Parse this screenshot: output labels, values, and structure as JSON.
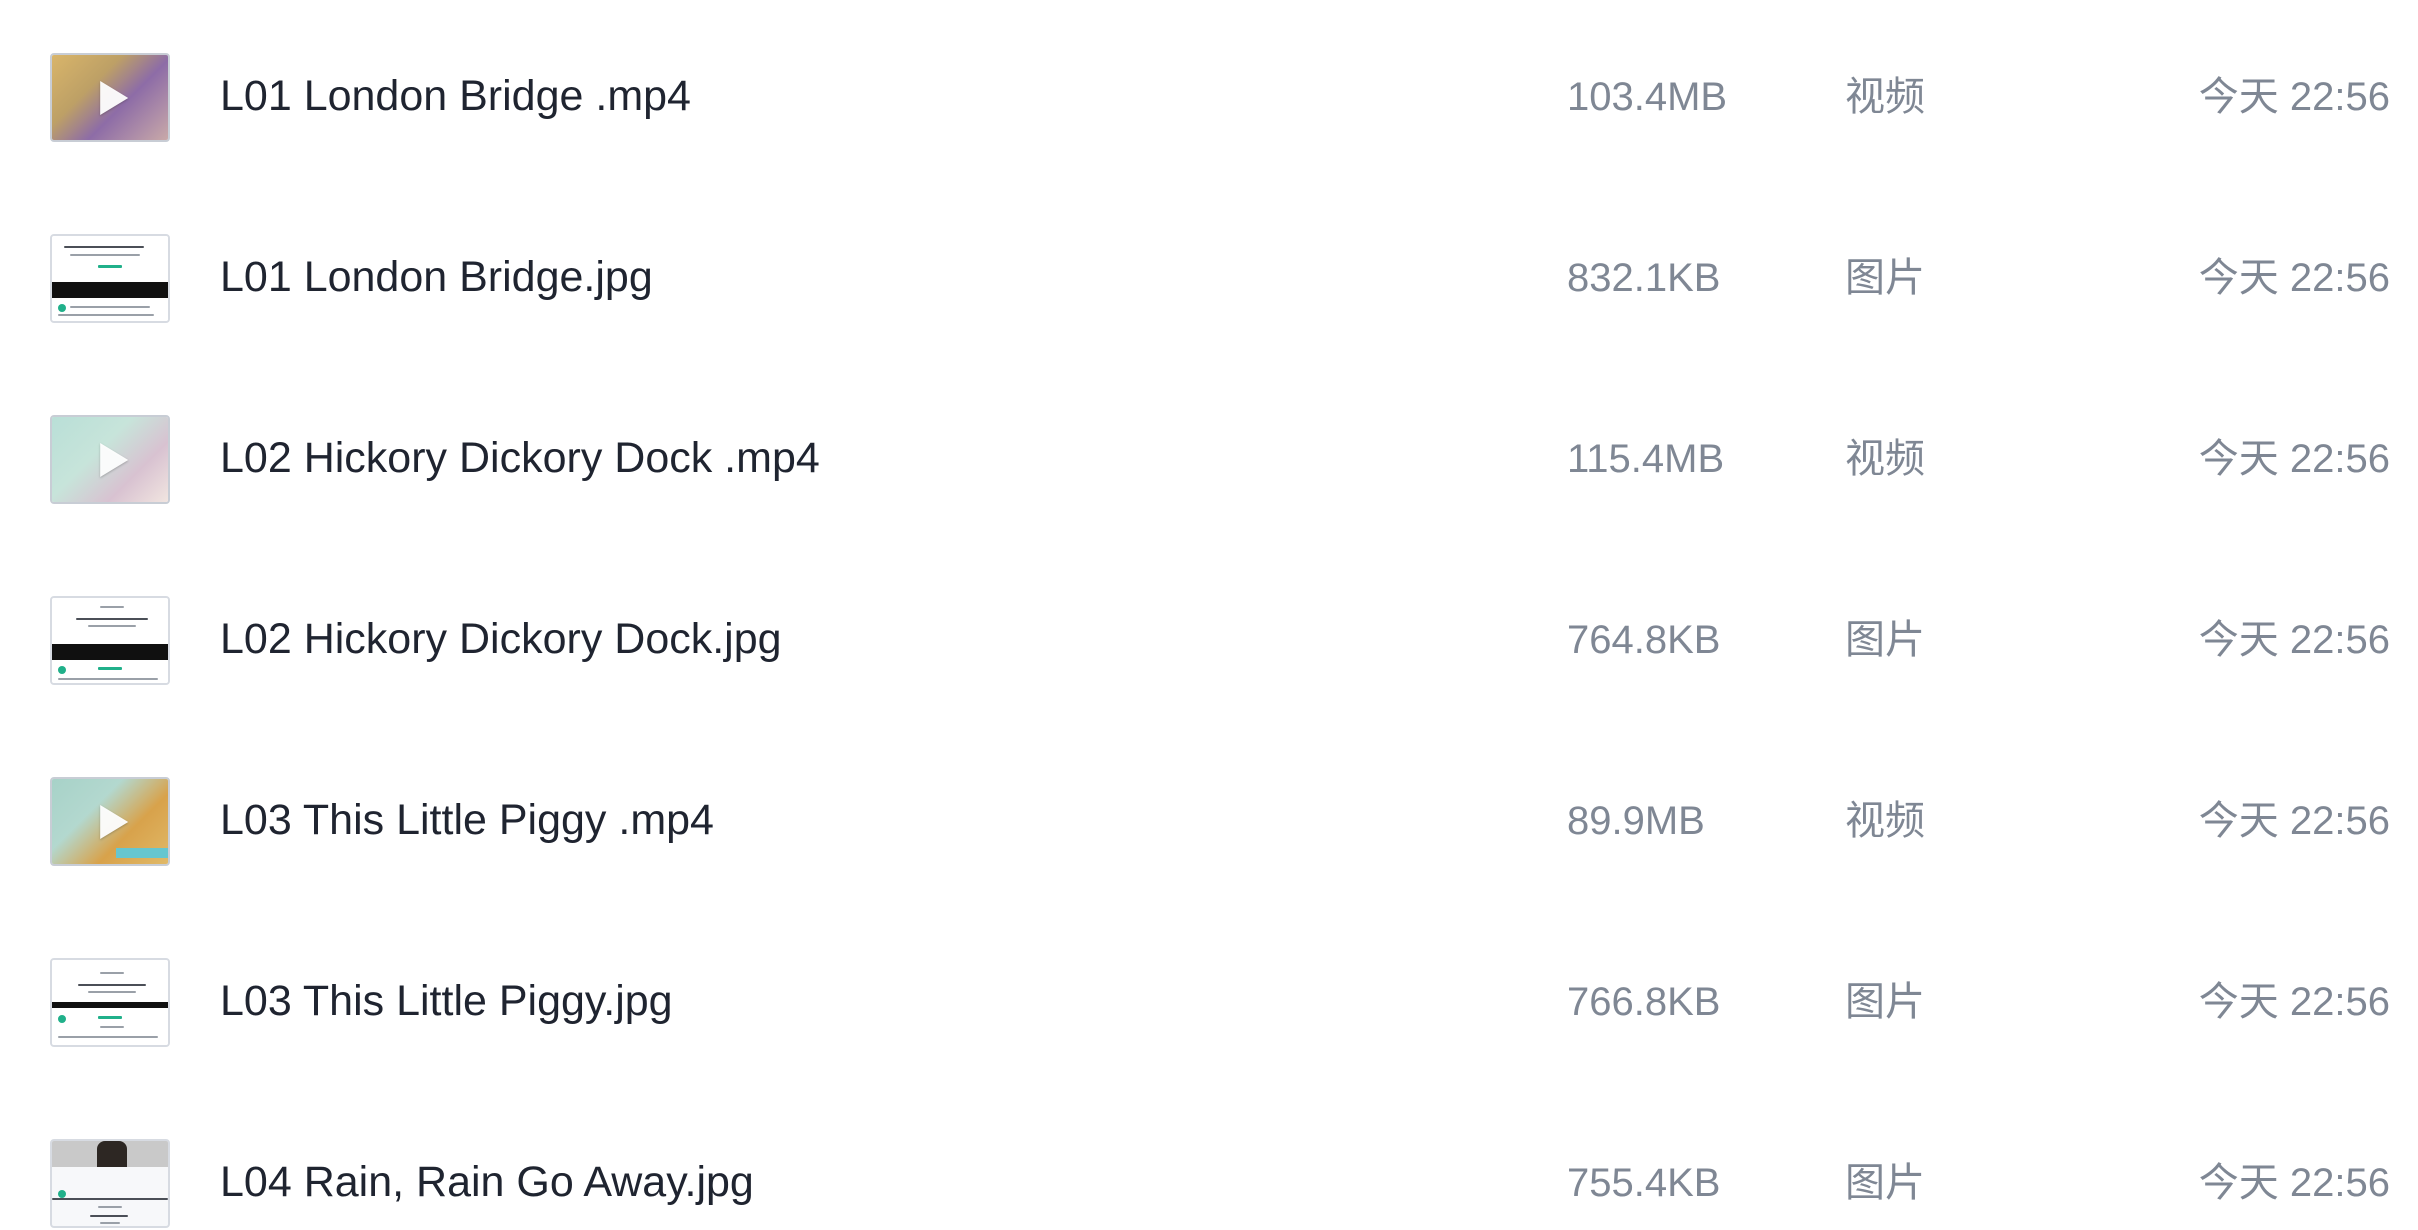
{
  "files": [
    {
      "name": "L01 London Bridge .mp4",
      "size": "103.4MB",
      "type": "视频",
      "time": "今天 22:56",
      "thumbnail": "video-thumbnail-icon"
    },
    {
      "name": "L01 London Bridge.jpg",
      "size": "832.1KB",
      "type": "图片",
      "time": "今天 22:56",
      "thumbnail": "image-thumbnail-icon"
    },
    {
      "name": "L02 Hickory Dickory Dock .mp4",
      "size": "115.4MB",
      "type": "视频",
      "time": "今天 22:56",
      "thumbnail": "video-thumbnail-icon"
    },
    {
      "name": "L02 Hickory Dickory Dock.jpg",
      "size": "764.8KB",
      "type": "图片",
      "time": "今天 22:56",
      "thumbnail": "image-thumbnail-icon"
    },
    {
      "name": "L03 This Little Piggy .mp4",
      "size": "89.9MB",
      "type": "视频",
      "time": "今天 22:56",
      "thumbnail": "video-thumbnail-icon"
    },
    {
      "name": "L03 This Little Piggy.jpg",
      "size": "766.8KB",
      "type": "图片",
      "time": "今天 22:56",
      "thumbnail": "image-thumbnail-icon"
    },
    {
      "name": "L04 Rain, Rain Go Away.jpg",
      "size": "755.4KB",
      "type": "图片",
      "time": "今天 22:56",
      "thumbnail": "image-thumbnail-icon"
    }
  ],
  "colors": {
    "primary_text": "#1f2430",
    "secondary_text": "#7f8794",
    "accent_green": "#20b08a"
  }
}
